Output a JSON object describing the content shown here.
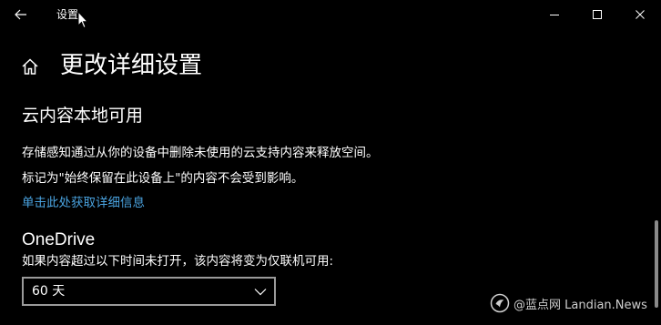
{
  "window": {
    "title": "设置",
    "back_icon": "arrow-left-icon",
    "controls": [
      "minimize-icon",
      "maximize-icon",
      "close-icon"
    ]
  },
  "page": {
    "title": "更改详细设置",
    "home_icon": "home-icon"
  },
  "cloud_section": {
    "title": "云内容本地可用",
    "description_1": "存储感知通过从你的设备中删除未使用的云支持内容来释放空间。",
    "description_2": "标记为\"始终保留在此设备上\"的内容不会受到影响。",
    "link": "单击此处获取详细信息"
  },
  "onedrive_section": {
    "title": "OneDrive",
    "description": "如果内容超过以下时间未打开，该内容将变为仅联机可用:",
    "dropdown_value": "60 天",
    "dropdown_icon": "chevron-down-icon"
  },
  "watermark": {
    "text": "@蓝点网 Landian.News"
  },
  "colors": {
    "background": "#000000",
    "text": "#ffffff",
    "link": "#4aa3e0",
    "dropdown_border": "#9a9a9a",
    "scrollbar": "#8a8a8a"
  }
}
